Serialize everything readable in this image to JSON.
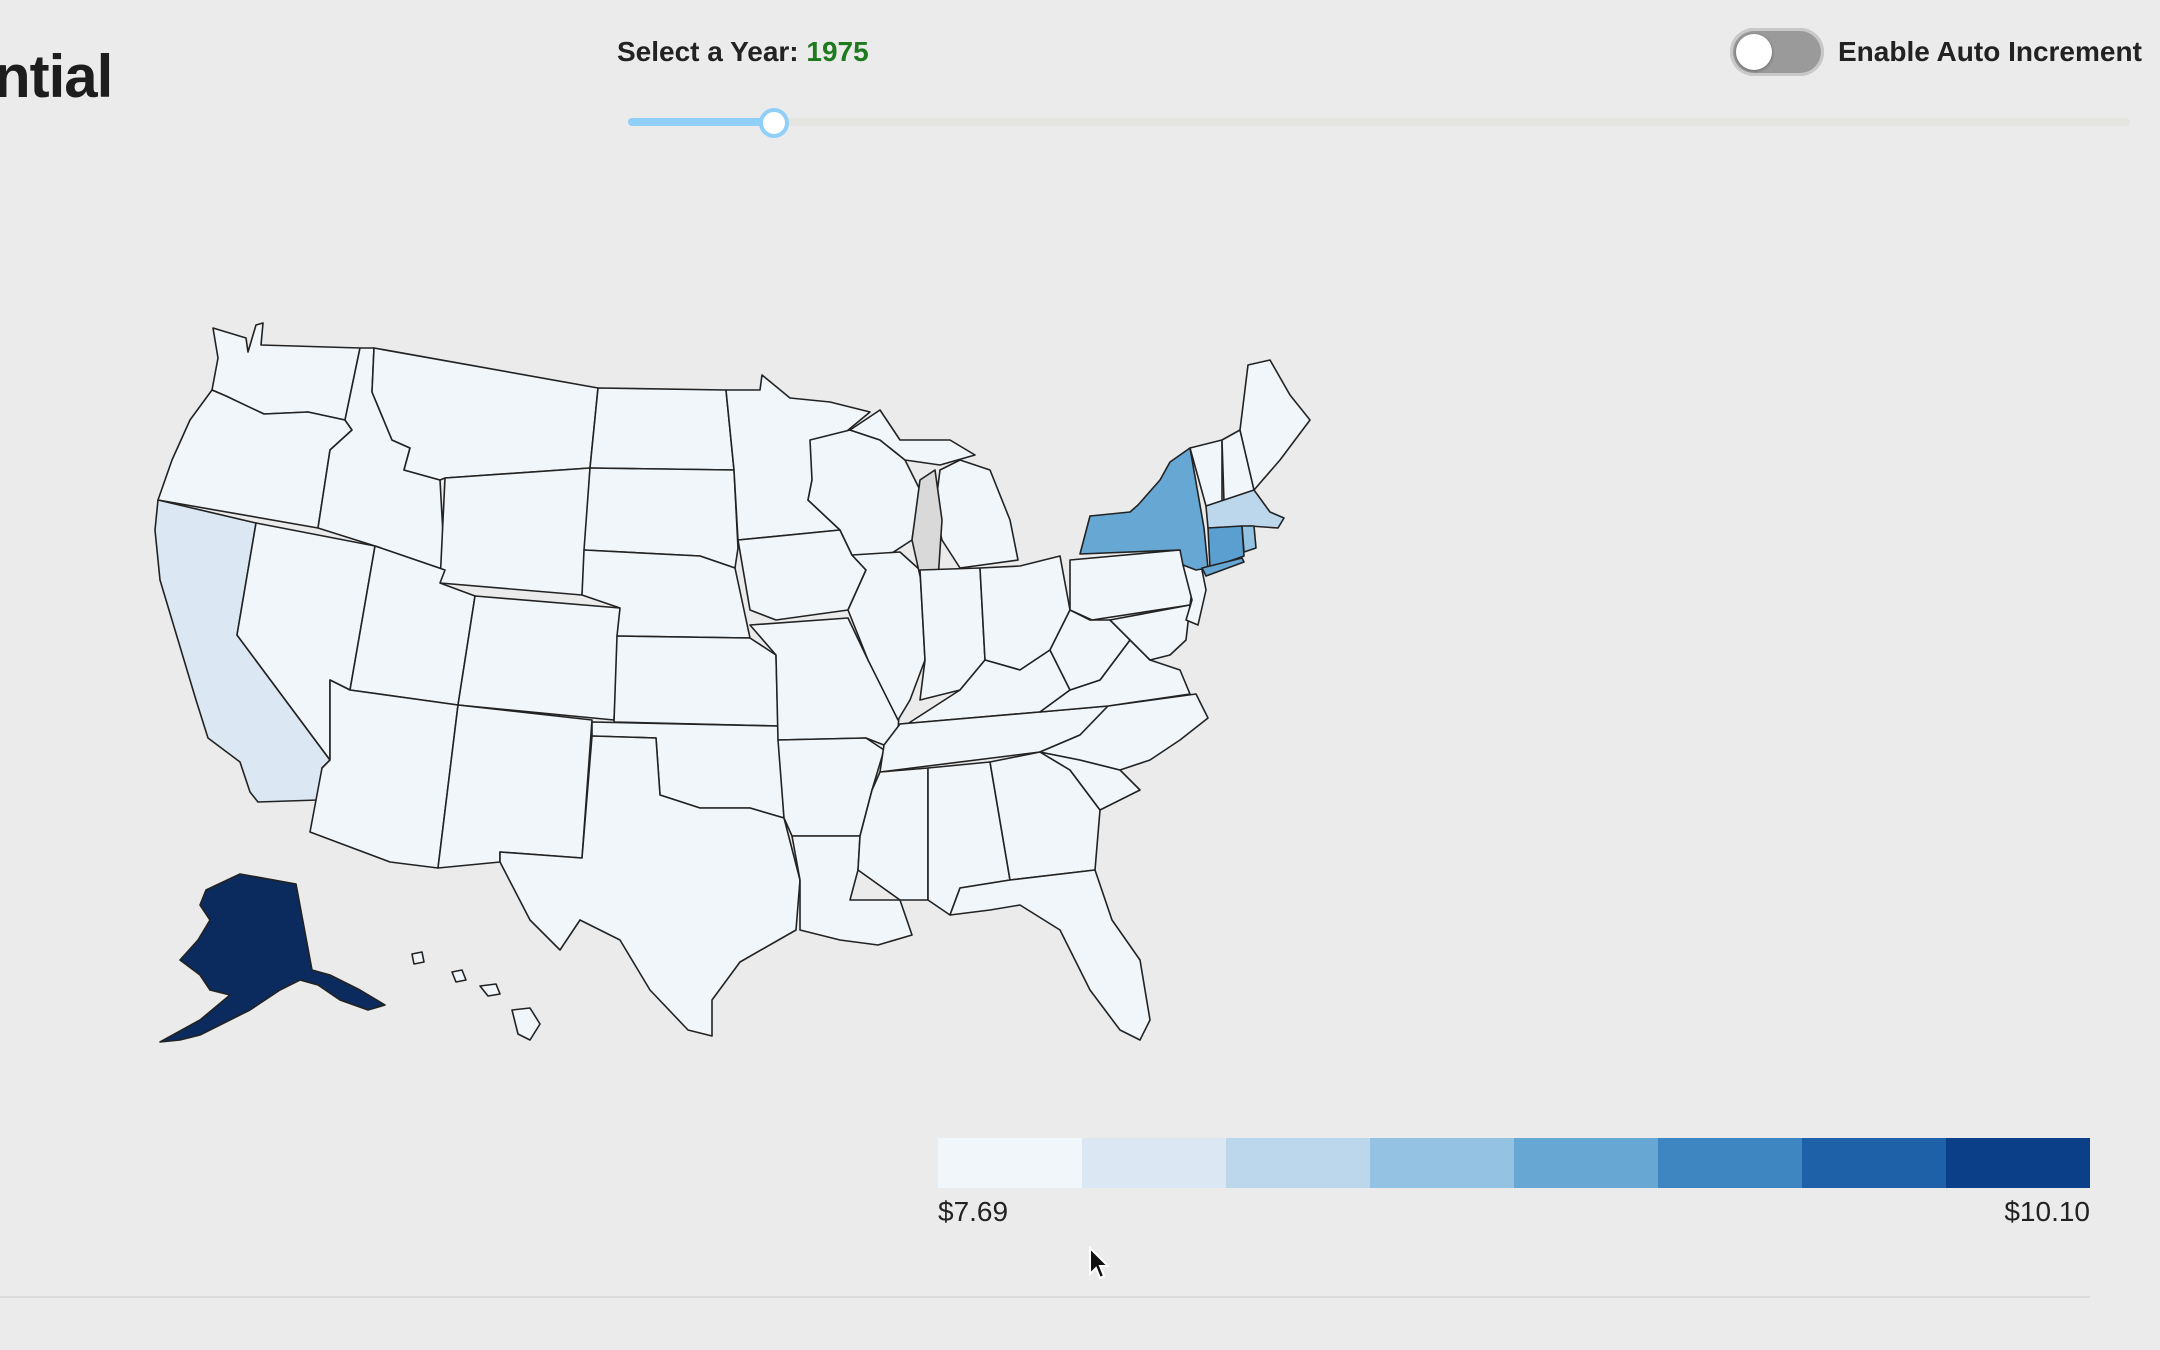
{
  "header": {
    "title_partial": "ntial"
  },
  "controls": {
    "year_label": "Select a Year:",
    "selected_year": "1975",
    "slider_value_fraction": 0.097,
    "auto_increment_label": "Enable Auto Increment",
    "auto_increment_enabled": false
  },
  "legend": {
    "min_label": "$7.69",
    "max_label": "$10.10",
    "colors": [
      "#f1f6fa",
      "#dbe8f3",
      "#bcd6ec",
      "#94c2e2",
      "#66a7d3",
      "#3d86c2",
      "#1e61a8",
      "#0b3f88"
    ]
  },
  "map": {
    "base_color": "#f1f6fa",
    "lake_color": "#d9d9d9",
    "highlighted_states": {
      "California": "#dbe8f3",
      "Alaska": "#0b2a5e",
      "New York": "#66a7d3",
      "Connecticut": "#5a9fd0",
      "Massachusetts": "#bcd6ec",
      "Rhode Island": "#94c2e2"
    }
  }
}
